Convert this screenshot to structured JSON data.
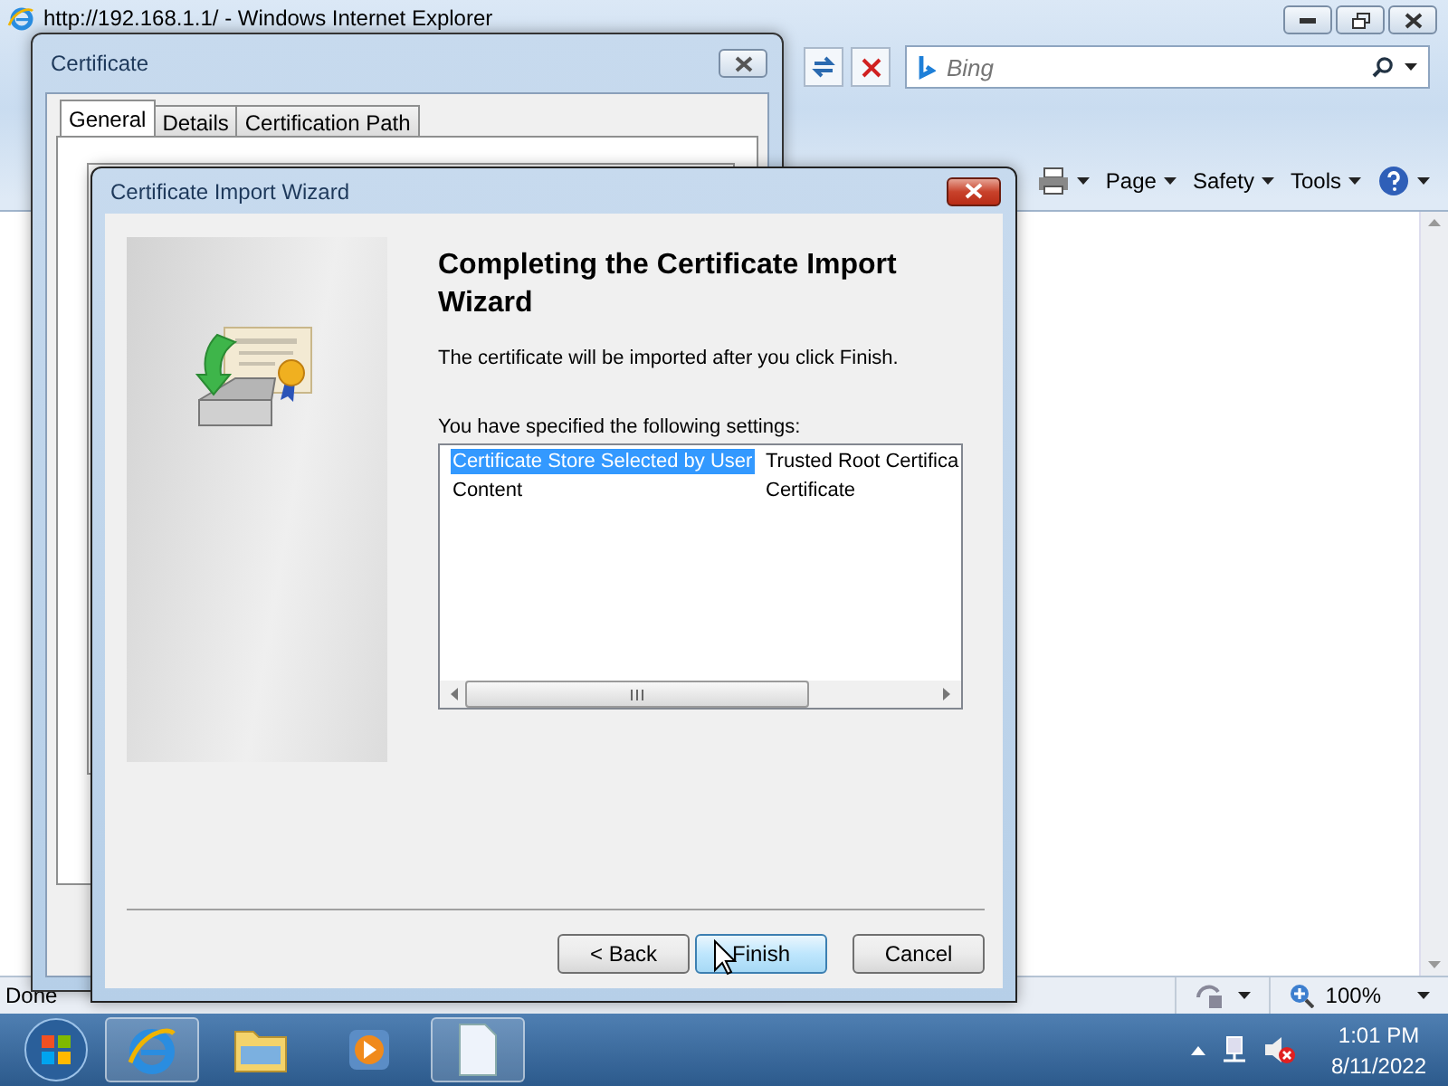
{
  "browser": {
    "title": "http://192.168.1.1/ - Windows Internet Explorer",
    "search": {
      "placeholder": "Bing"
    },
    "command_bar": [
      {
        "label": "Page"
      },
      {
        "label": "Safety"
      },
      {
        "label": "Tools"
      }
    ],
    "status_bar": {
      "text": "Done",
      "zoom": "100%"
    }
  },
  "certificate_dialog": {
    "title": "Certificate",
    "tabs": [
      {
        "label": "General",
        "selected": true
      },
      {
        "label": "Details",
        "selected": false
      },
      {
        "label": "Certification Path",
        "selected": false
      }
    ]
  },
  "wizard": {
    "title": "Certificate Import Wizard",
    "heading": "Completing the Certificate Import Wizard",
    "message": "The certificate will be imported after you click Finish.",
    "settings_label": "You have specified the following settings:",
    "settings": [
      {
        "name": "Certificate Store Selected by User",
        "value": "Trusted Root Certifica",
        "selected": true
      },
      {
        "name": "Content",
        "value": "Certificate",
        "selected": false
      }
    ],
    "buttons": [
      {
        "label": "< Back",
        "focused": false
      },
      {
        "label": "Finish",
        "focused": true
      },
      {
        "label": "Cancel",
        "focused": false
      }
    ]
  },
  "taskbar": {
    "apps": [
      {
        "kind": "ie",
        "running": true
      },
      {
        "kind": "explorer",
        "running": false
      },
      {
        "kind": "media",
        "running": false
      },
      {
        "kind": "document",
        "running": true
      }
    ],
    "clock": {
      "time": "1:01 PM",
      "date": "8/11/2022"
    }
  }
}
